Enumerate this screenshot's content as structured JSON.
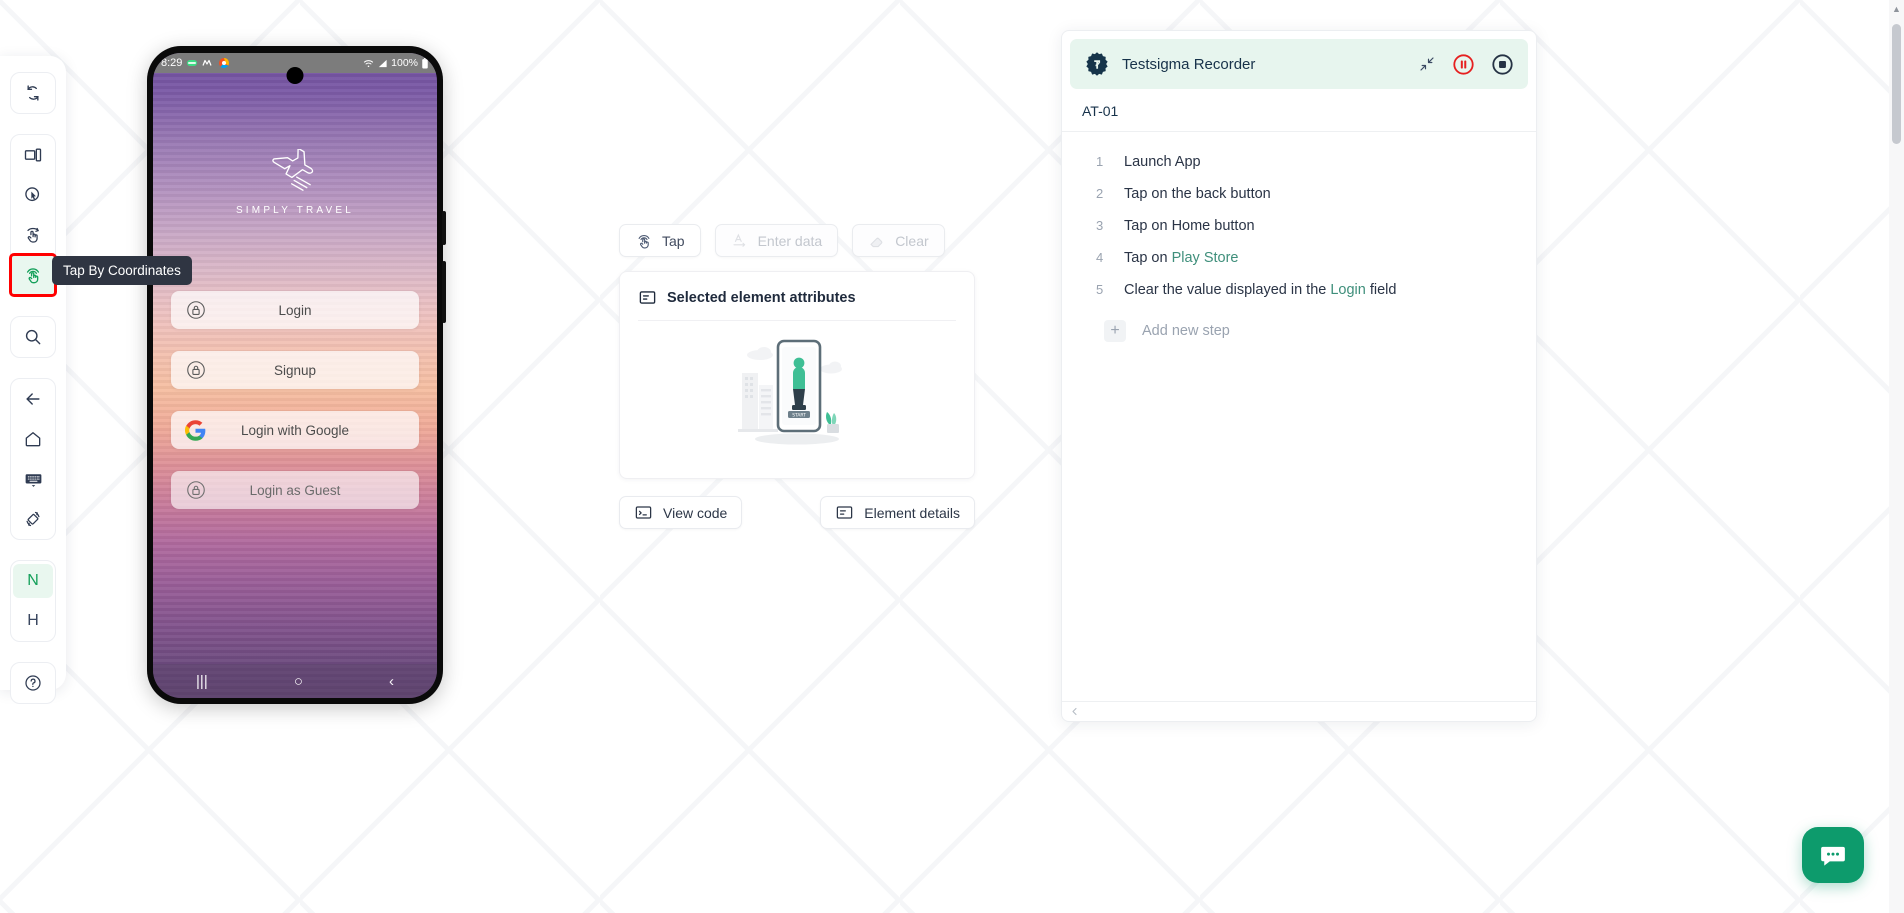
{
  "left_rail": {
    "groups": [
      {
        "items": [
          {
            "name": "refresh-icon",
            "label": "Refresh"
          }
        ]
      },
      {
        "items": [
          {
            "name": "device-screen-icon",
            "label": "Device Screen"
          },
          {
            "name": "inspect-element-icon",
            "label": "Inspect Element"
          },
          {
            "name": "swipe-icon",
            "label": "Swipe"
          },
          {
            "name": "tap-by-coordinates-icon",
            "label": "Tap By Coordinates",
            "active": true
          }
        ]
      },
      {
        "items": [
          {
            "name": "search-icon",
            "label": "Search"
          }
        ]
      },
      {
        "items": [
          {
            "name": "back-icon",
            "label": "Back"
          },
          {
            "name": "home-icon",
            "label": "Home"
          },
          {
            "name": "keyboard-icon",
            "label": "Keyboard"
          },
          {
            "name": "rotate-icon",
            "label": "Rotate"
          }
        ]
      },
      {
        "items": [
          {
            "name": "native-toggle",
            "label": "N",
            "selected": true
          },
          {
            "name": "hybrid-toggle",
            "label": "H",
            "selected": false
          }
        ]
      },
      {
        "items": [
          {
            "name": "help-icon",
            "label": "Help"
          }
        ]
      }
    ],
    "tooltip": "Tap By Coordinates"
  },
  "phone": {
    "status_bar": {
      "time": "8:29",
      "battery": "100%"
    },
    "app": {
      "logo_text": "SIMPLY TRAVEL",
      "buttons": [
        {
          "label": "Login",
          "icon": "lock-icon"
        },
        {
          "label": "Signup",
          "icon": "lock-icon"
        },
        {
          "label": "Login with Google",
          "icon": "google-icon"
        },
        {
          "label": "Login as Guest",
          "icon": "lock-icon"
        }
      ]
    },
    "nav": {
      "recents": "|||",
      "home": "○",
      "back": "‹"
    }
  },
  "center": {
    "actions": [
      {
        "label": "Tap",
        "icon": "tap-icon",
        "disabled": false
      },
      {
        "label": "Enter data",
        "icon": "text-input-icon",
        "disabled": true
      },
      {
        "label": "Clear",
        "icon": "eraser-icon",
        "disabled": true
      }
    ],
    "card": {
      "title": "Selected element attributes",
      "title_icon": "attributes-icon",
      "illustration": "mobile-testing-illustration"
    },
    "bottom_actions": [
      {
        "label": "View code",
        "icon": "code-icon"
      },
      {
        "label": "Element details",
        "icon": "details-icon"
      }
    ]
  },
  "recorder": {
    "title": "Testsigma Recorder",
    "logo_icon": "testsigma-gear-icon",
    "header_actions": [
      {
        "name": "collapse-icon",
        "label": "Collapse"
      },
      {
        "name": "pause-icon",
        "label": "Pause"
      },
      {
        "name": "stop-icon",
        "label": "Stop"
      }
    ],
    "test_case": "AT-01",
    "steps": [
      {
        "num": "1",
        "text": "Launch App",
        "highlight": ""
      },
      {
        "num": "2",
        "text": "Tap on the back button",
        "highlight": ""
      },
      {
        "num": "3",
        "text": "Tap on Home button",
        "highlight": ""
      },
      {
        "num": "4",
        "text": "Tap on ",
        "highlight": "Play Store",
        "tail": ""
      },
      {
        "num": "5",
        "text": "Clear the value displayed in the ",
        "highlight": "Login",
        "tail": " field"
      }
    ],
    "add_step_label": "Add new step",
    "add_step_icon": "plus-icon"
  },
  "chat": {
    "icon": "chat-icon",
    "color": "#0d9b6c"
  },
  "colors": {
    "accent_green": "#14a05a",
    "highlight_red": "#ff0000",
    "recorder_header_bg": "#e7f5ee",
    "step_highlight": "#3f8f7b"
  }
}
